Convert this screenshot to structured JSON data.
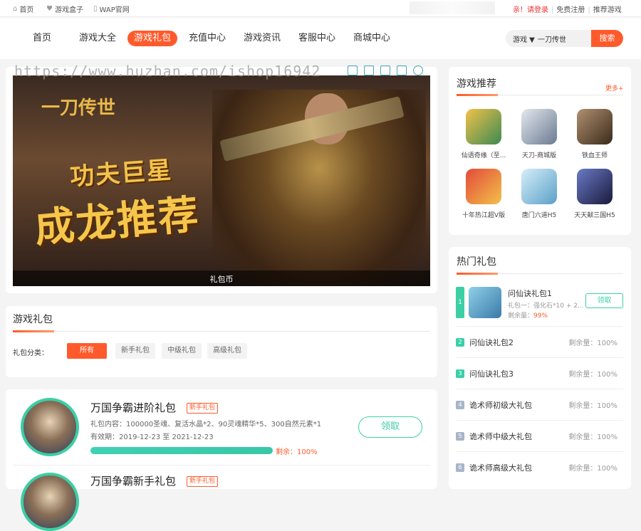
{
  "topbar": {
    "home": "首页",
    "box": "游戏盒子",
    "wap": "WAP官网",
    "login": "亲！请登录",
    "register": "免费注册",
    "recommend": "推荐游戏"
  },
  "nav": {
    "items": [
      "首页",
      "游戏大全",
      "游戏礼包",
      "充值中心",
      "游戏资讯",
      "客服中心",
      "商城中心"
    ],
    "active_index": 2
  },
  "search": {
    "select": "游戏 ▼",
    "value": "一刀传世",
    "button": "搜索"
  },
  "banner": {
    "watermark": "https://www.huzhan.com/ishop16942",
    "logo": "一刀传世",
    "headline1": "功夫巨星",
    "headline2": "成龙推荐",
    "caption": "礼包币"
  },
  "gifts": {
    "title": "游戏礼包",
    "filter_label": "礼包分类：",
    "filters": [
      "所有",
      "新手礼包",
      "中级礼包",
      "高级礼包"
    ],
    "active_filter": 0,
    "items": [
      {
        "name": "万国争霸进阶礼包",
        "tag": "新手礼包",
        "content": "礼包内容：100000圣魂、复活水晶*2、90灵魂精华*5、300自然元素*1",
        "validity": "有效期：2019-12-23 至 2021-12-23",
        "remaining": "剩余：100%",
        "remaining_pct": 100,
        "button": "领取"
      },
      {
        "name": "万国争霸新手礼包",
        "tag": "新手礼包"
      }
    ]
  },
  "recommend": {
    "title": "游戏推荐",
    "more": "更多+",
    "games": [
      "仙语奇缘（至...",
      "天刀-商城版",
      "铁血王师",
      "十年热江超V版",
      "唐门六道H5",
      "天天献三国H5"
    ],
    "colors": [
      "#3b8a52",
      "#c8d4e0",
      "#6a5640",
      "#c23a2a",
      "#8fc7e0",
      "#3a4a8a"
    ]
  },
  "hot": {
    "title": "热门礼包",
    "top": {
      "rank": "1",
      "name": "问仙诀礼包1",
      "desc": "礼包一：强化石*10 + 2...",
      "remain_label": "剩余量：",
      "remain": "99%",
      "button": "领取"
    },
    "items": [
      {
        "rank": "2",
        "name": "问仙诀礼包2",
        "remain": "剩余量：100%",
        "color": "#3ccfa6"
      },
      {
        "rank": "3",
        "name": "问仙诀礼包3",
        "remain": "剩余量：100%",
        "color": "#3ccfa6"
      },
      {
        "rank": "4",
        "name": "诡术师初级大礼包",
        "remain": "剩余量：100%",
        "color": "#a8b4c8"
      },
      {
        "rank": "5",
        "name": "诡术师中级大礼包",
        "remain": "剩余量：100%",
        "color": "#a8b4c8"
      },
      {
        "rank": "6",
        "name": "诡术师高级大礼包",
        "remain": "剩余量：100%",
        "color": "#a8b4c8"
      }
    ]
  }
}
